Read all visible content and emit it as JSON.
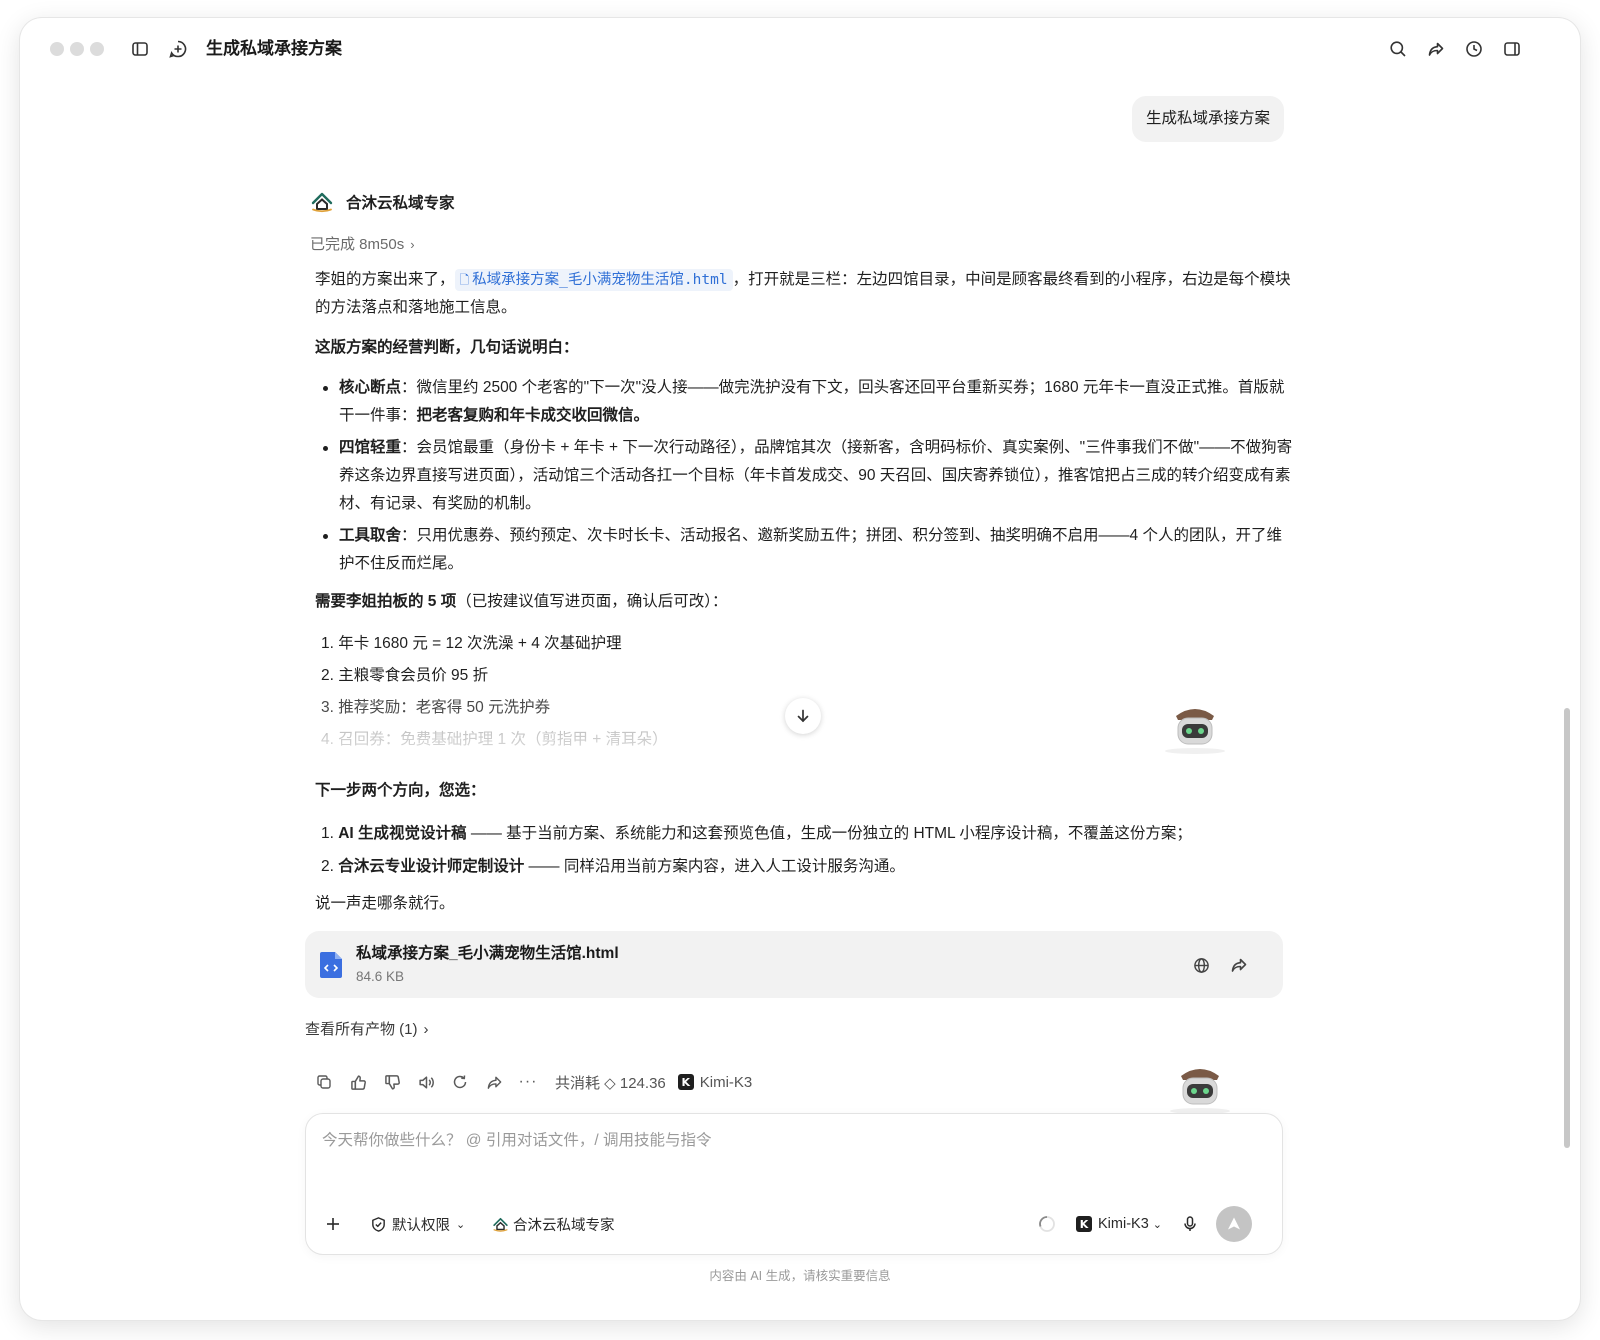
{
  "window": {
    "title": "生成私域承接方案"
  },
  "user_message": "生成私域承接方案",
  "agent": {
    "name": "合沐云私域专家",
    "status": "已完成 8m50s"
  },
  "reply": {
    "intro_before": "李姐的方案出来了，",
    "file_link": "私域承接方案_毛小满宠物生活馆.html",
    "intro_after": "，打开就是三栏：左边四馆目录，中间是顾客最终看到的小程序，右边是每个模块的方法落点和落地施工信息。",
    "judgement_heading": "这版方案的经营判断，几句话说明白：",
    "bullets": [
      {
        "title": "核心断点",
        "text": "：微信里约 2500 个老客的\"下一次\"没人接——做完洗护没有下文，回头客还回平台重新买券；1680 元年卡一直没正式推。首版就干一件事：",
        "bold_tail": "把老客复购和年卡成交收回微信。"
      },
      {
        "title": "四馆轻重",
        "text": "：会员馆最重（身份卡 + 年卡 + 下一次行动路径），品牌馆其次（接新客，含明码标价、真实案例、\"三件事我们不做\"——不做狗寄养这条边界直接写进页面），活动馆三个活动各扛一个目标（年卡首发成交、90 天召回、国庆寄养锁位），推客馆把占三成的转介绍变成有素材、有记录、有奖励的机制。",
        "bold_tail": ""
      },
      {
        "title": "工具取舍",
        "text": "：只用优惠券、预约预定、次卡时长卡、活动报名、邀新奖励五件；拼团、积分签到、抽奖明确不启用——4 个人的团队，开了维护不住反而烂尾。",
        "bold_tail": ""
      }
    ],
    "confirm_heading_bold": "需要李姐拍板的 5 项",
    "confirm_heading_rest": "（已按建议值写进页面，确认后可改）：",
    "confirm_items": [
      "1. 年卡 1680 元 = 12 次洗澡 + 4 次基础护理",
      "2. 主粮零食会员价 95 折",
      "3. 推荐奖励：老客得 50 元洗护券",
      "4. 召回券：免费基础护理 1 次（剪指甲 + 清耳朵）"
    ],
    "next_heading": "下一步两个方向，您选：",
    "next_items": [
      {
        "num": "1. ",
        "title": "AI 生成视觉设计稿",
        "text": " —— 基于当前方案、系统能力和这套预览色值，生成一份独立的 HTML 小程序设计稿，不覆盖这份方案；"
      },
      {
        "num": "2. ",
        "title": "合沐云专业设计师定制设计",
        "text": " —— 同样沿用当前方案内容，进入人工设计服务沟通。"
      }
    ],
    "closing": "说一声走哪条就行。"
  },
  "file_card": {
    "name": "私域承接方案_毛小满宠物生活馆.html",
    "size": "84.6 KB"
  },
  "all_products": "查看所有产物 (1)",
  "usage": {
    "label": "共消耗 ◇ 124.36",
    "model": "Kimi-K3"
  },
  "composer": {
    "placeholder": "今天帮你做些什么？ @ 引用对话文件，/ 调用技能与指令",
    "permission": "默认权限",
    "agent": "合沐云私域专家",
    "model": "Kimi-K3"
  },
  "disclaimer": "内容由 AI 生成，请核实重要信息",
  "colors": {
    "link": "#2f6fd6",
    "file_icon": "#3b6fe0",
    "send_disabled": "#c4c4c4"
  }
}
